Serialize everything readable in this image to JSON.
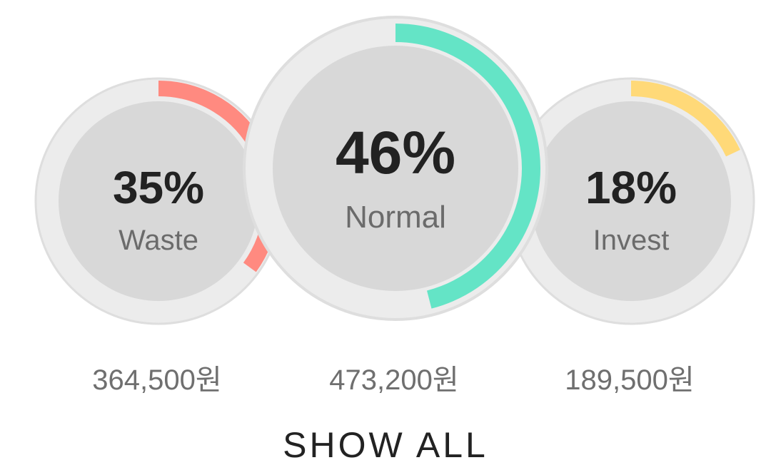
{
  "categories": [
    {
      "key": "waste",
      "percent_label": "35%",
      "name": "Waste",
      "amount": "364,500원",
      "fraction": 0.35,
      "color": "#FF8A80"
    },
    {
      "key": "normal",
      "percent_label": "46%",
      "name": "Normal",
      "amount": "473,200원",
      "fraction": 0.46,
      "color": "#64E4C6"
    },
    {
      "key": "invest",
      "percent_label": "18%",
      "name": "Invest",
      "amount": "189,500원",
      "fraction": 0.18,
      "color": "#FFD978"
    }
  ],
  "show_all_label": "SHOW ALL"
}
